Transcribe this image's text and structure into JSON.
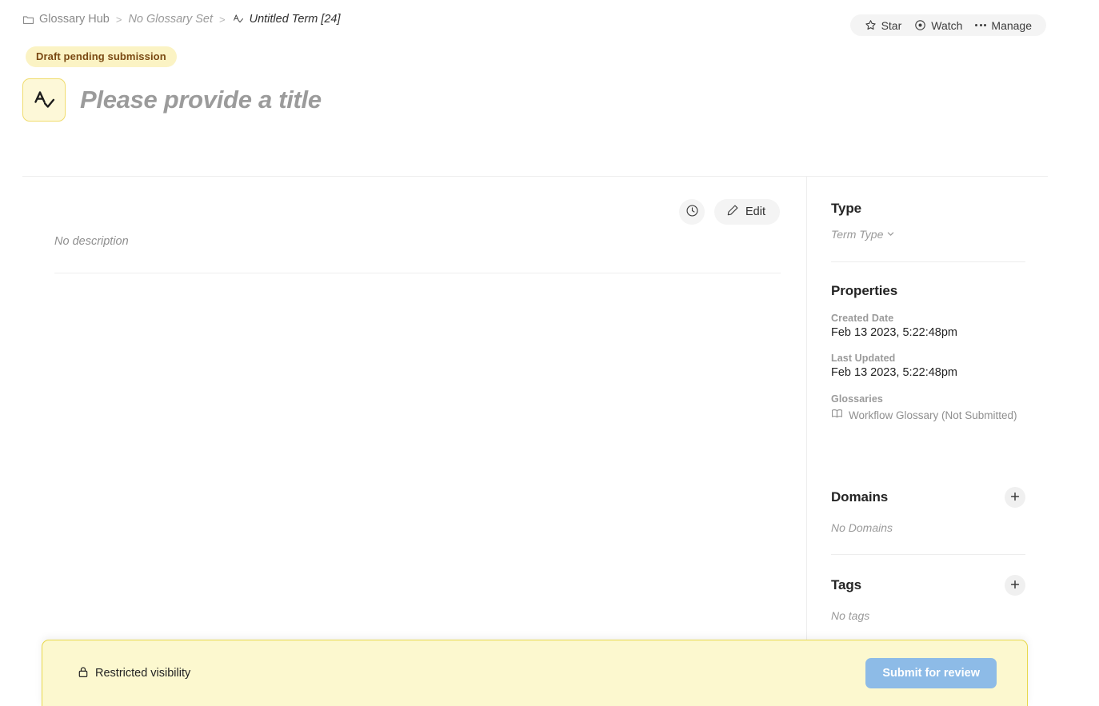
{
  "breadcrumb": {
    "items": [
      {
        "label": "Glossary Hub",
        "icon": "folder-icon",
        "style": "normal"
      },
      {
        "label": "No Glossary Set",
        "icon": "none",
        "style": "italic"
      },
      {
        "label": "Untitled Term [24]",
        "icon": "term-icon",
        "style": "current"
      }
    ],
    "separator": ">"
  },
  "header_actions": {
    "star_label": "Star",
    "watch_label": "Watch",
    "manage_label": "Manage"
  },
  "entity": {
    "status_badge": "Draft pending submission",
    "title": "Please provide a title",
    "icon": "term-icon"
  },
  "document": {
    "history_icon": "clock-icon",
    "edit_label": "Edit",
    "description_placeholder": "No description"
  },
  "sidebar": {
    "type": {
      "heading": "Type",
      "value": "Term Type"
    },
    "properties": {
      "heading": "Properties",
      "fields": [
        {
          "label": "Created Date",
          "value": "Feb 13 2023, 5:22:48pm"
        },
        {
          "label": "Last Updated",
          "value": "Feb 13 2023, 5:22:48pm"
        }
      ],
      "glossaries_label": "Glossaries",
      "glossary_value": "Workflow Glossary (Not Submitted)"
    },
    "domains": {
      "heading": "Domains",
      "empty": "No Domains",
      "add_icon": "plus-icon"
    },
    "tags": {
      "heading": "Tags",
      "empty": "No tags",
      "add_icon": "plus-icon"
    }
  },
  "bottom_bar": {
    "visibility_label": "Restricted visibility",
    "visibility_icon": "lock-icon",
    "submit_label": "Submit for review"
  },
  "colors": {
    "badge_bg": "#fbf3c4",
    "badge_text": "#7a4a13",
    "banner_bg": "#fcf8cf",
    "banner_border": "#e8d84a",
    "submit_bg": "#8dbbe7",
    "pill_bg": "#f4f4f4"
  }
}
